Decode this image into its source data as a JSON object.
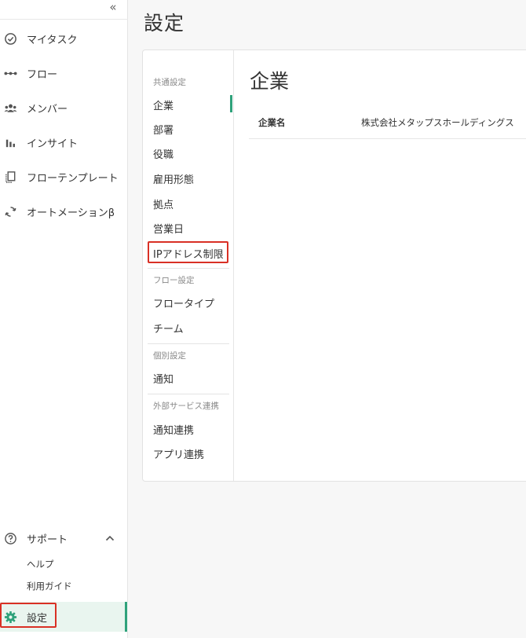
{
  "sidebar": {
    "collapse_label": "«",
    "items": [
      {
        "label": "マイタスク",
        "icon": "check-circle-icon"
      },
      {
        "label": "フロー",
        "icon": "flow-icon"
      },
      {
        "label": "メンバー",
        "icon": "members-icon"
      },
      {
        "label": "インサイト",
        "icon": "bar-chart-icon"
      },
      {
        "label": "フローテンプレート",
        "icon": "template-icon"
      },
      {
        "label": "オートメーションβ",
        "icon": "sync-icon"
      }
    ],
    "support": {
      "label": "サポート",
      "icon": "help-circle-icon",
      "expanded": true,
      "children": [
        "ヘルプ",
        "利用ガイド"
      ]
    },
    "settings": {
      "label": "設定",
      "icon": "gear-icon",
      "active": true
    }
  },
  "page": {
    "title": "設定"
  },
  "settings_nav": {
    "groups": [
      {
        "label": "共通設定",
        "items": [
          "企業",
          "部署",
          "役職",
          "雇用形態",
          "拠点",
          "営業日",
          "IPアドレス制限"
        ]
      },
      {
        "label": "フロー設定",
        "items": [
          "フロータイプ",
          "チーム"
        ]
      },
      {
        "label": "個別設定",
        "items": [
          "通知"
        ]
      },
      {
        "label": "外部サービス連携",
        "items": [
          "通知連携",
          "アプリ連携"
        ]
      }
    ],
    "active_item": "企業"
  },
  "content": {
    "title": "企業",
    "field_label": "企業名",
    "field_value": "株式会社メタップスホールディングス"
  },
  "colors": {
    "accent": "#2fa27b",
    "highlight": "#d93025",
    "active_bg": "#e9f5ef"
  }
}
